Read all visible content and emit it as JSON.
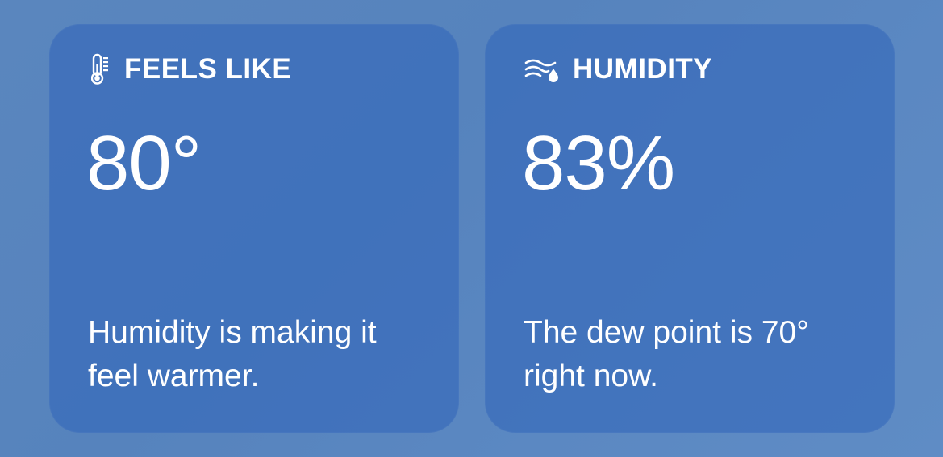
{
  "feels_like": {
    "icon": "thermometer-icon",
    "title": "FEELS LIKE",
    "value": "80°",
    "description": "Humidity is making it feel warmer."
  },
  "humidity": {
    "icon": "humidity-icon",
    "title": "HUMIDITY",
    "value": "83%",
    "description": "The dew point is 70° right now."
  },
  "colors": {
    "background": "#5a86be",
    "card": "#3f72bf",
    "text": "#ffffff"
  }
}
